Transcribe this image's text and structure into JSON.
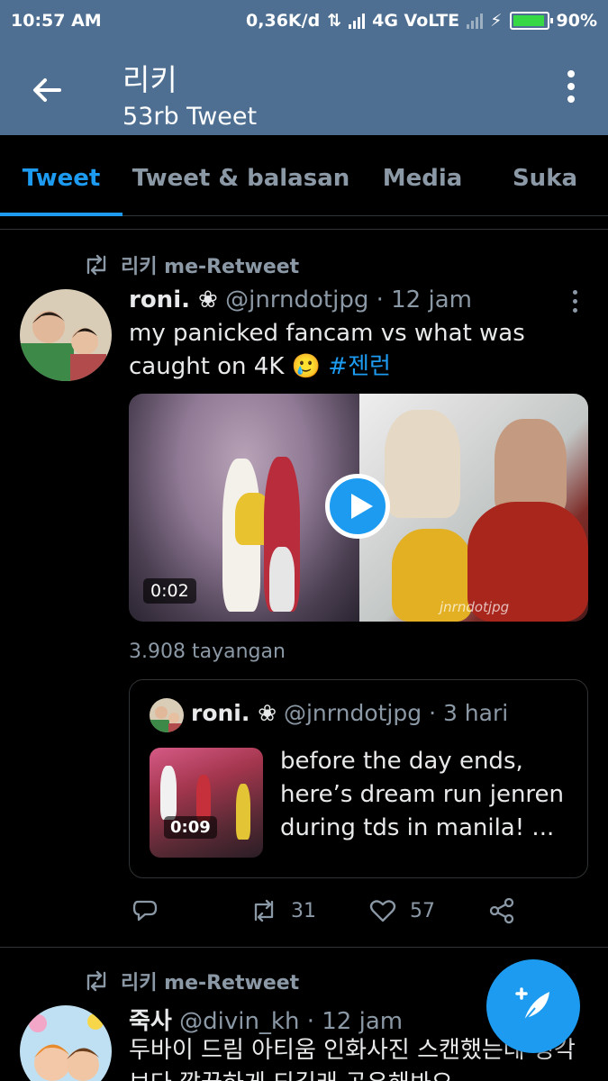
{
  "status_bar": {
    "time": "10:57 AM",
    "network_speed": "0,36K/d",
    "network_type": "4G VoLTE",
    "battery": "90%"
  },
  "header": {
    "title": "리키",
    "subtitle": "53rb Tweet"
  },
  "tabs": [
    {
      "label": "Tweet",
      "active": true
    },
    {
      "label": "Tweet & balasan",
      "active": false
    },
    {
      "label": "Media",
      "active": false
    },
    {
      "label": "Suka",
      "active": false
    }
  ],
  "tweets": [
    {
      "retweeted_by": "리키 me-Retweet",
      "name": "roni. ❀",
      "handle": "@jnrndotjpg",
      "time": "· 12 jam",
      "text": "my panicked fancam vs what was caught on 4K 🥲",
      "hashtag": "#젠런",
      "video_duration": "0:02",
      "watermark": "jnrndotjpg",
      "views": "3.908 tayangan",
      "quote": {
        "name": "roni. ❀",
        "handle": "@jnrndotjpg",
        "time": "· 3 hari",
        "text": "before the day ends, here’s dream run jenren during tds in manila! ...",
        "video_duration": "0:09"
      },
      "retweets": "31",
      "likes": "57"
    },
    {
      "retweeted_by": "리키 me-Retweet",
      "name": "죽사",
      "handle": "@divin_kh",
      "time": "· 12 jam",
      "text": "두바이 드림 아티움 인화사진 스캔했는데 생각보다 깔끔하게 되길래 공유해봐요"
    }
  ],
  "colors": {
    "header": "#4e6f91",
    "accent": "#1d9bf0",
    "background": "#000000"
  }
}
